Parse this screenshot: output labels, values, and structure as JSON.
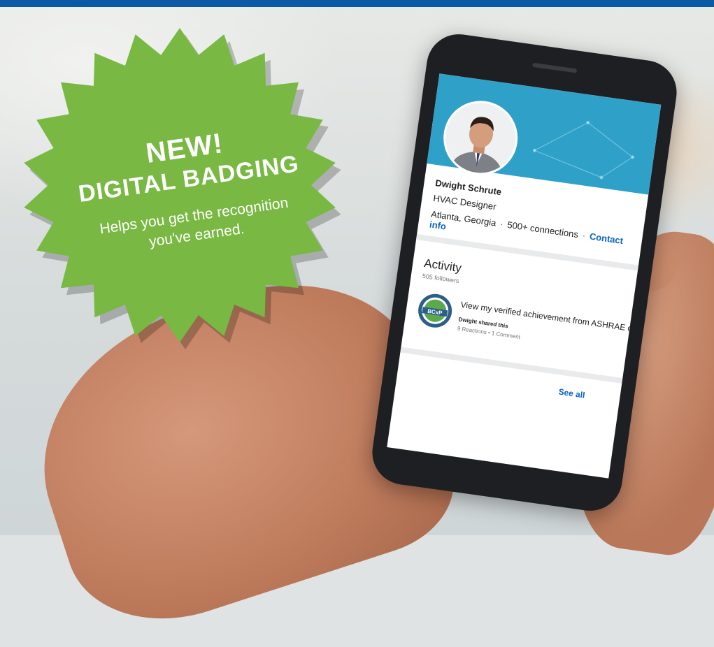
{
  "promo": {
    "headline_new": "NEW!",
    "headline_title": "DIGITAL BADGING",
    "subtitle_line1": "Helps you get the recognition",
    "subtitle_line2": "you've earned.",
    "burst_color": "#78b843",
    "top_bar_color": "#0a5aa6"
  },
  "profile": {
    "name": "Dwight Schrute",
    "title": "HVAC Designer",
    "location": "Atlanta, Georgia",
    "connections": "500+ connections",
    "contact_label": "Contact info"
  },
  "activity": {
    "title": "Activity",
    "followers": "505 followers",
    "post_text": "View my verified achievement from ASHRAE on",
    "post_author": "Dwight shared this",
    "post_stats": "9 Reactions • 1 Comment",
    "see_all": "See all",
    "badge_label": "BCxP"
  }
}
